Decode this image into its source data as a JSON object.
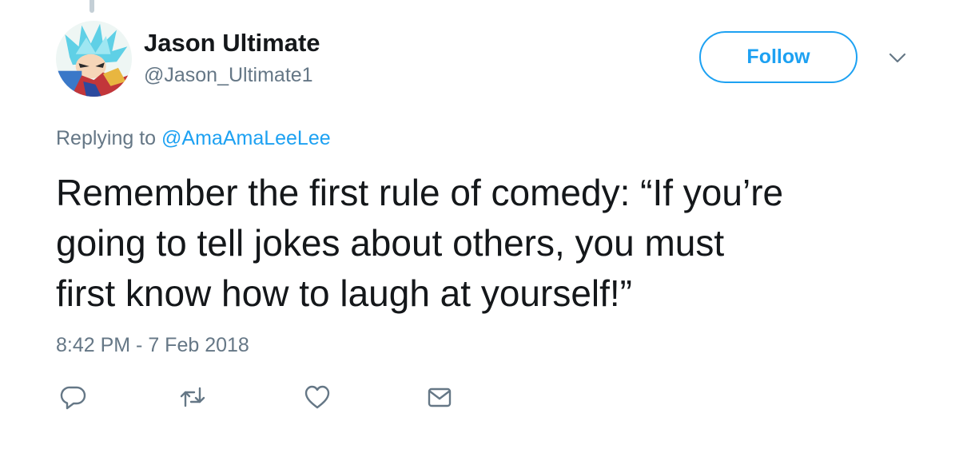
{
  "tweet": {
    "author": {
      "display_name": "Jason Ultimate",
      "handle": "@Jason_Ultimate1",
      "avatar_icon": "anime-character-avatar"
    },
    "follow_label": "Follow",
    "menu_icon": "chevron-down-icon",
    "replying_prefix": "Replying to",
    "replying_to": "@AmaAmaLeeLee",
    "text_lines": [
      "Remember the first rule of comedy: “If you’re",
      "going to tell jokes about others, you must",
      "first know how to laugh at yourself!”"
    ],
    "timestamp": "8:42 PM - 7 Feb 2018",
    "actions": [
      {
        "name": "reply",
        "icon": "reply-icon"
      },
      {
        "name": "retweet",
        "icon": "retweet-icon"
      },
      {
        "name": "like",
        "icon": "heart-icon"
      },
      {
        "name": "direct-message",
        "icon": "envelope-icon"
      }
    ]
  },
  "colors": {
    "accent": "#1da1f2",
    "text": "#14171a",
    "secondary_text": "#657786",
    "icon": "#657786",
    "thread_line": "#c4cfd6"
  }
}
